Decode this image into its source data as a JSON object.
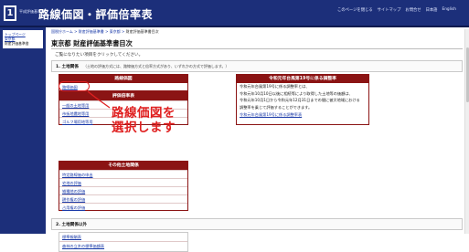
{
  "header": {
    "logo_mark": "1",
    "logo_caption": "平成評価基準書",
    "title": "路線価図・評価倍率表",
    "links": [
      "このページを閉じる",
      "サイトマップ",
      "お問合せ",
      "日本語",
      "English"
    ]
  },
  "sidebar": {
    "links": [
      "トップページ",
      "東京都"
    ],
    "current": "財産評価基準書"
  },
  "breadcrumb": {
    "items": [
      "国税庁ホーム",
      "財産評価基準書",
      "東京都"
    ],
    "current": "財産評価基準書目次"
  },
  "page_title": "東京都 財産評価基準書目次",
  "instruction": "ご覧になりたい項目をクリックしてください。",
  "section1": {
    "title": "1. 土地関係",
    "note": "（土地の評価方式には、路線価方式と倍率方式があり、いずれかの方式で評価します。）"
  },
  "rosenka_table": {
    "header": "路線価図",
    "link": "路線価図"
  },
  "bairitsu_table": {
    "header": "評価倍率表",
    "links": [
      "一般の土地等用",
      "市街地農地等用",
      "ゴルフ場用地等用"
    ]
  },
  "other_table": {
    "header": "その他土地関係",
    "links": [
      "特定路線価の申出",
      "宅地の評価",
      "雑種地の評価",
      "耕作権の評価",
      "占用権の評価"
    ]
  },
  "notice_table": {
    "header": "令和元年台風第19号に係る調整率",
    "lines": [
      "令和元年台風第19号に係る調整率とは、",
      "令和元年10月10日以後に相続等により取得した土地等の価額は、",
      "令和元年10月1日から令和元年12月31日までの間に被災地域における",
      "調整率を乗じて評価することができます。"
    ],
    "link": "令和元年台風第19号に係る調整率表"
  },
  "section2": {
    "title": "2. 土地関係以外",
    "links": [
      "標準報酬表",
      "森林の立木の標準価額表"
    ]
  },
  "annotation": {
    "callout": "路線価図を\n選択します",
    "color": "#e02020"
  }
}
